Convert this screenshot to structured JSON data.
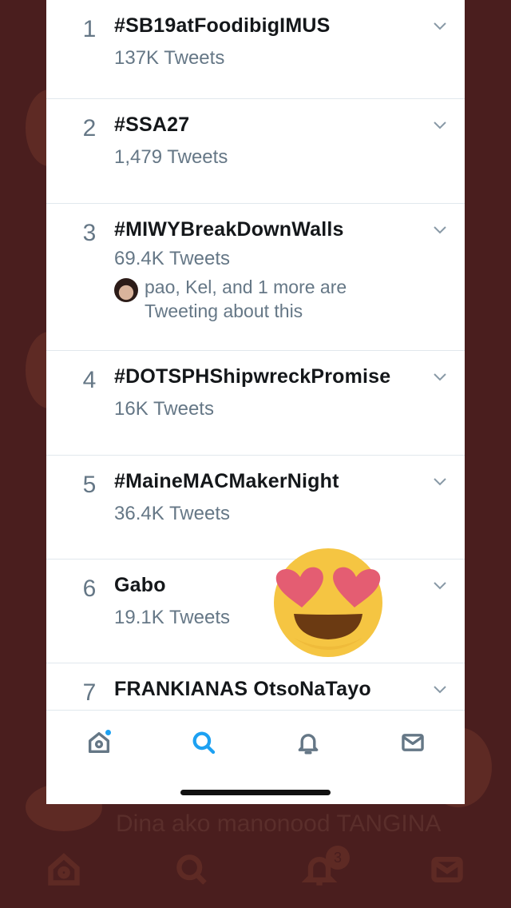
{
  "trends": [
    {
      "rank": "1",
      "name": "#SB19atFoodibigIMUS",
      "count": "137K Tweets"
    },
    {
      "rank": "2",
      "name": "#SSA27",
      "count": "1,479 Tweets"
    },
    {
      "rank": "3",
      "name": "#MIWYBreakDownWalls",
      "count": "69.4K Tweets",
      "context": "pao, Kel, and 1 more are Tweeting about this"
    },
    {
      "rank": "4",
      "name": "#DOTSPHShipwreckPromise",
      "count": "16K Tweets"
    },
    {
      "rank": "5",
      "name": "#MaineMACMakerNight",
      "count": "36.4K Tweets"
    },
    {
      "rank": "6",
      "name": "Gabo",
      "count": "19.1K Tweets"
    },
    {
      "rank": "7",
      "name": "FRANKIANAS OtsoNaTayo",
      "count": ""
    }
  ],
  "tabs": [
    {
      "icon": "home-icon",
      "active": false,
      "has_dot": true
    },
    {
      "icon": "search-icon",
      "active": true,
      "has_dot": false
    },
    {
      "icon": "bell-icon",
      "active": false,
      "has_dot": false
    },
    {
      "icon": "mail-icon",
      "active": false,
      "has_dot": false
    }
  ],
  "background": {
    "partial_text": "Dina ako manonood TANGINA",
    "badge": "3"
  },
  "colors": {
    "accent": "#1da1f2",
    "text_primary": "#14171a",
    "text_secondary": "#657786",
    "backdrop": "#4a1e1e"
  },
  "sticker": "heart-eyes-emoji"
}
